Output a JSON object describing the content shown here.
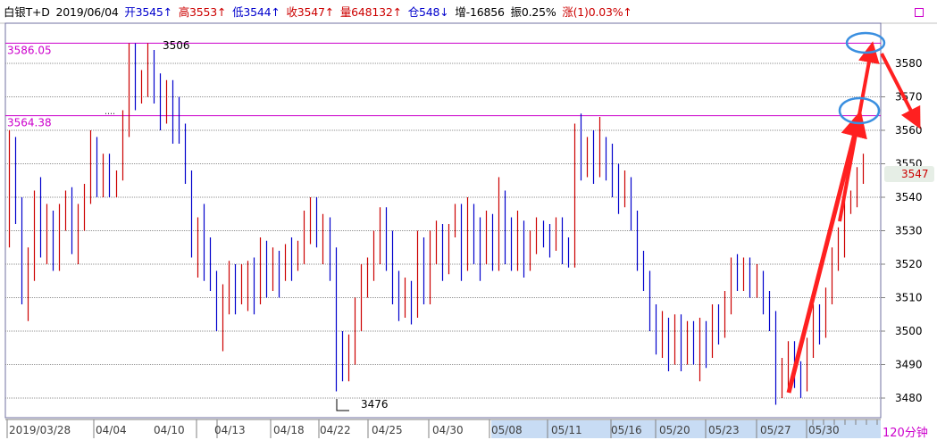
{
  "header": {
    "instrument": "白银T+D",
    "date": "2019/06/04",
    "open": "开3545↑",
    "high": "高3553↑",
    "low": "低3544↑",
    "close": "收3547↑",
    "volume": "量648132↑",
    "position": "仓548↓",
    "increase": "增-16856",
    "amplitude": "振0.25%",
    "change": "涨(1)0.03%↑"
  },
  "period_label": "120分钟",
  "chart_data": {
    "type": "candlestick",
    "title": "",
    "xlabel": "",
    "ylabel": "",
    "ylim": [
      3473,
      3602
    ],
    "y_ticks": [
      3480,
      3490,
      3500,
      3510,
      3520,
      3530,
      3540,
      3550,
      3560,
      3570,
      3580
    ],
    "x_tick_labels": [
      "2019/03/28",
      "04/04",
      "04/10",
      "04/13",
      "04/18",
      "04/22",
      "04/25",
      "04/30",
      "05/08",
      "05/11",
      "05/16",
      "05/20",
      "05/23",
      "05/27",
      "05/30"
    ],
    "grid": true,
    "levels": [
      {
        "label": "3586.05",
        "value": 3586.05
      },
      {
        "label": "3564.38",
        "value": 3564.38
      }
    ],
    "annotations": [
      {
        "text": "3506",
        "value": 3586
      },
      {
        "text": "3476",
        "value": 3477
      }
    ],
    "last_price_label": "3547",
    "last_price": 3547,
    "colors": {
      "up": "#cc0000",
      "down": "#0000cc",
      "level": "#cc00cc",
      "arrow": "#ff2020",
      "circle": "#3a8fe0",
      "axis_label": "#000000"
    },
    "candles": [
      [
        3535,
        3555,
        3525,
        3560
      ],
      [
        3555,
        3537,
        3532,
        3558
      ],
      [
        3537,
        3512,
        3508,
        3540
      ],
      [
        3512,
        3520,
        3503,
        3525
      ],
      [
        3518,
        3540,
        3515,
        3542
      ],
      [
        3540,
        3528,
        3522,
        3546
      ],
      [
        3528,
        3535,
        3520,
        3538
      ],
      [
        3535,
        3522,
        3518,
        3536
      ],
      [
        3522,
        3535,
        3518,
        3538
      ],
      [
        3535,
        3540,
        3530,
        3542
      ],
      [
        3540,
        3527,
        3523,
        3543
      ],
      [
        3527,
        3535,
        3520,
        3538
      ],
      [
        3535,
        3540,
        3530,
        3544
      ],
      [
        3540,
        3555,
        3538,
        3560
      ],
      [
        3555,
        3545,
        3540,
        3558
      ],
      [
        3545,
        3550,
        3540,
        3553
      ],
      [
        3550,
        3543,
        3540,
        3553
      ],
      [
        3543,
        3546,
        3540,
        3548
      ],
      [
        3546,
        3562,
        3545,
        3566
      ],
      [
        3562,
        3582,
        3558,
        3586
      ],
      [
        3582,
        3570,
        3566,
        3586
      ],
      [
        3570,
        3574,
        3568,
        3578
      ],
      [
        3574,
        3580,
        3570,
        3586
      ],
      [
        3580,
        3572,
        3568,
        3584
      ],
      [
        3572,
        3566,
        3560,
        3577
      ],
      [
        3566,
        3572,
        3562,
        3575
      ],
      [
        3572,
        3564,
        3556,
        3575
      ],
      [
        3564,
        3558,
        3556,
        3570
      ],
      [
        3558,
        3545,
        3544,
        3562
      ],
      [
        3545,
        3526,
        3522,
        3548
      ],
      [
        3526,
        3531,
        3516,
        3534
      ],
      [
        3531,
        3525,
        3515,
        3538
      ],
      [
        3525,
        3514,
        3512,
        3528
      ],
      [
        3514,
        3503,
        3500,
        3518
      ],
      [
        3503,
        3509,
        3494,
        3514
      ],
      [
        3509,
        3517,
        3505,
        3521
      ],
      [
        3517,
        3510,
        3505,
        3520
      ],
      [
        3510,
        3516,
        3508,
        3520
      ],
      [
        3516,
        3518,
        3506,
        3521
      ],
      [
        3518,
        3510,
        3505,
        3522
      ],
      [
        3510,
        3524,
        3508,
        3528
      ],
      [
        3524,
        3516,
        3510,
        3527
      ],
      [
        3516,
        3521,
        3512,
        3525
      ],
      [
        3521,
        3518,
        3510,
        3524
      ],
      [
        3518,
        3523,
        3515,
        3526
      ],
      [
        3523,
        3520,
        3515,
        3528
      ],
      [
        3520,
        3523,
        3518,
        3527
      ],
      [
        3523,
        3530,
        3520,
        3536
      ],
      [
        3530,
        3540,
        3526,
        3540
      ],
      [
        3540,
        3528,
        3525,
        3540
      ],
      [
        3528,
        3532,
        3520,
        3535
      ],
      [
        3532,
        3522,
        3515,
        3534
      ],
      [
        3522,
        3495,
        3482,
        3525
      ],
      [
        3495,
        3486,
        3485,
        3500
      ],
      [
        3486,
        3495,
        3485,
        3499
      ],
      [
        3495,
        3510,
        3490,
        3510
      ],
      [
        3510,
        3516,
        3500,
        3520
      ],
      [
        3516,
        3520,
        3510,
        3522
      ],
      [
        3520,
        3525,
        3515,
        3530
      ],
      [
        3525,
        3535,
        3520,
        3537
      ],
      [
        3535,
        3526,
        3518,
        3537
      ],
      [
        3526,
        3512,
        3508,
        3530
      ],
      [
        3512,
        3508,
        3503,
        3518
      ],
      [
        3508,
        3512,
        3504,
        3516
      ],
      [
        3512,
        3507,
        3502,
        3515
      ],
      [
        3507,
        3525,
        3504,
        3530
      ],
      [
        3525,
        3513,
        3508,
        3528
      ],
      [
        3513,
        3526,
        3508,
        3530
      ],
      [
        3526,
        3530,
        3520,
        3533
      ],
      [
        3530,
        3520,
        3515,
        3532
      ],
      [
        3520,
        3530,
        3517,
        3532
      ],
      [
        3530,
        3536,
        3528,
        3538
      ],
      [
        3536,
        3519,
        3515,
        3538
      ],
      [
        3519,
        3535,
        3518,
        3540
      ],
      [
        3535,
        3532,
        3520,
        3538
      ],
      [
        3532,
        3524,
        3515,
        3534
      ],
      [
        3524,
        3532,
        3520,
        3536
      ],
      [
        3532,
        3520,
        3518,
        3535
      ],
      [
        3520,
        3540,
        3518,
        3546
      ],
      [
        3540,
        3531,
        3520,
        3542
      ],
      [
        3531,
        3520,
        3518,
        3534
      ],
      [
        3520,
        3530,
        3518,
        3536
      ],
      [
        3530,
        3521,
        3516,
        3533
      ],
      [
        3521,
        3527,
        3518,
        3530
      ],
      [
        3527,
        3531,
        3523,
        3534
      ],
      [
        3531,
        3529,
        3525,
        3533
      ],
      [
        3529,
        3526,
        3522,
        3532
      ],
      [
        3526,
        3531,
        3524,
        3534
      ],
      [
        3531,
        3522,
        3520,
        3534
      ],
      [
        3522,
        3521,
        3519,
        3528
      ],
      [
        3521,
        3558,
        3519,
        3562
      ],
      [
        3558,
        3551,
        3545,
        3565
      ],
      [
        3551,
        3555,
        3546,
        3558
      ],
      [
        3555,
        3548,
        3544,
        3560
      ],
      [
        3548,
        3555,
        3546,
        3564
      ],
      [
        3555,
        3551,
        3545,
        3558
      ],
      [
        3551,
        3545,
        3540,
        3556
      ],
      [
        3545,
        3540,
        3535,
        3550
      ],
      [
        3540,
        3544,
        3537,
        3548
      ],
      [
        3544,
        3535,
        3530,
        3546
      ],
      [
        3535,
        3520,
        3518,
        3536
      ],
      [
        3520,
        3517,
        3512,
        3524
      ],
      [
        3517,
        3505,
        3500,
        3518
      ],
      [
        3505,
        3496,
        3493,
        3508
      ],
      [
        3496,
        3503,
        3492,
        3506
      ],
      [
        3503,
        3495,
        3488,
        3504
      ],
      [
        3495,
        3502,
        3490,
        3505
      ],
      [
        3502,
        3496,
        3488,
        3505
      ],
      [
        3496,
        3500,
        3490,
        3503
      ],
      [
        3500,
        3496,
        3490,
        3503
      ],
      [
        3496,
        3502,
        3485,
        3504
      ],
      [
        3502,
        3494,
        3489,
        3503
      ],
      [
        3494,
        3505,
        3492,
        3508
      ],
      [
        3505,
        3500,
        3496,
        3508
      ],
      [
        3500,
        3508,
        3498,
        3512
      ],
      [
        3508,
        3520,
        3505,
        3522
      ],
      [
        3520,
        3515,
        3512,
        3523
      ],
      [
        3515,
        3520,
        3512,
        3522
      ],
      [
        3520,
        3514,
        3510,
        3522
      ],
      [
        3514,
        3516,
        3510,
        3520
      ],
      [
        3516,
        3510,
        3505,
        3518
      ],
      [
        3510,
        3503,
        3500,
        3512
      ],
      [
        3503,
        3482,
        3478,
        3506
      ],
      [
        3482,
        3487,
        3480,
        3492
      ],
      [
        3487,
        3494,
        3482,
        3497
      ],
      [
        3494,
        3489,
        3483,
        3497
      ],
      [
        3489,
        3487,
        3480,
        3491
      ],
      [
        3487,
        3495,
        3482,
        3498
      ],
      [
        3495,
        3505,
        3492,
        3508
      ],
      [
        3505,
        3500,
        3496,
        3508
      ],
      [
        3500,
        3510,
        3498,
        3513
      ],
      [
        3510,
        3520,
        3508,
        3525
      ],
      [
        3520,
        3525,
        3518,
        3531
      ],
      [
        3525,
        3538,
        3522,
        3540
      ],
      [
        3538,
        3540,
        3535,
        3542
      ],
      [
        3540,
        3546,
        3537,
        3549
      ],
      [
        3546,
        3547,
        3544,
        3553
      ]
    ]
  }
}
